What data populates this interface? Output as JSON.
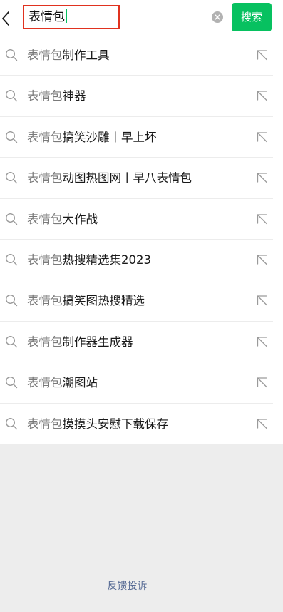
{
  "search": {
    "query": "表情包",
    "button_label": "搜索"
  },
  "suggestions": [
    {
      "keyword": "表情包",
      "rest": "制作工具"
    },
    {
      "keyword": "表情包",
      "rest": "神器"
    },
    {
      "keyword": "表情包",
      "rest": "搞笑沙雕丨早上坏"
    },
    {
      "keyword": "表情包",
      "rest": "动图热图网丨早八表情包"
    },
    {
      "keyword": "表情包",
      "rest": "大作战"
    },
    {
      "keyword": "表情包",
      "rest": "热搜精选集2023"
    },
    {
      "keyword": "表情包",
      "rest": "搞笑图热搜精选"
    },
    {
      "keyword": "表情包",
      "rest": "制作器生成器"
    },
    {
      "keyword": "表情包",
      "rest": "潮图站"
    },
    {
      "keyword": "表情包",
      "rest": "摸摸头安慰下载保存"
    }
  ],
  "footer": {
    "feedback_label": "反馈投诉"
  },
  "icons": {
    "back": "chevron-left-icon",
    "clear": "clear-circle-icon",
    "suggestion": "search-icon",
    "fill": "arrow-up-left-icon"
  },
  "colors": {
    "accent": "#07c160",
    "highlight_frame": "#e0321f",
    "link": "#576b95",
    "footer_bg": "#ededed",
    "keyword_text": "#7a7a7a",
    "suggestion_text": "#191919"
  }
}
